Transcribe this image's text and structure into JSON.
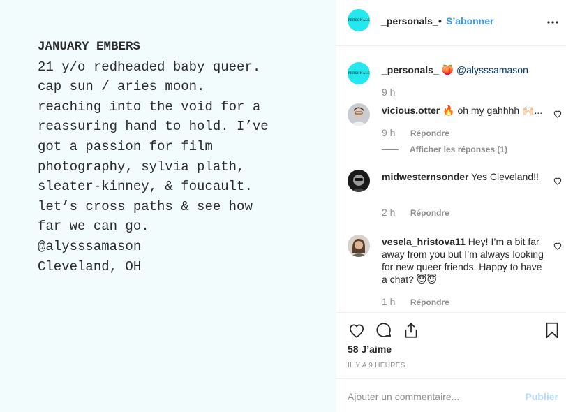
{
  "post_image": {
    "title": "JANUARY EMBERS",
    "lines": [
      "21 y/o redheaded baby queer.",
      "cap sun / aries moon.",
      "reaching into the void for a",
      "reassuring hand to hold. I’ve",
      "got a passion for film",
      "photography, sylvia plath,",
      "sleater-kinney, & foucault.",
      "let’s cross paths & see how",
      "far we can go.",
      "@alysssamason",
      "Cleveland, OH"
    ]
  },
  "header": {
    "avatar_text": "PERSONALS",
    "username": "_personals_",
    "separator": "•",
    "follow_label": "S’abonner",
    "more_icon": "more-horizontal-icon"
  },
  "caption": {
    "username": "_personals_",
    "emoji": "🍑",
    "mention": "@alysssamason",
    "time": "9 h"
  },
  "comments": [
    {
      "username": "vicious.otter",
      "text": "🔥 oh my gahhhh 🙌🏻...",
      "time": "9 h",
      "reply_label": "Répondre",
      "view_replies": "Afficher les réponses (1)"
    },
    {
      "username": "midwesternsonder",
      "text": "Yes Cleveland!!",
      "time": "2 h",
      "reply_label": "Répondre"
    },
    {
      "username": "vesela_hristova11",
      "text": "Hey! I’m a bit far away from you but I’m always looking for new queer friends. Happy to have a chat? 😇😇",
      "time": "1 h",
      "reply_label": "Répondre"
    }
  ],
  "actions": {
    "icons": [
      "heart-icon",
      "comment-icon",
      "share-icon",
      "bookmark-icon"
    ],
    "likes": "58 J’aime",
    "time_ago": "IL Y A 9 HEURES"
  },
  "comment_box": {
    "placeholder": "Ajouter un commentaire...",
    "publish_label": "Publier"
  },
  "colors": {
    "accent": "#3897f0",
    "logo_bg": "#25e8ef",
    "image_bg": "#f3fcfc",
    "muted": "#8e8e8e"
  }
}
